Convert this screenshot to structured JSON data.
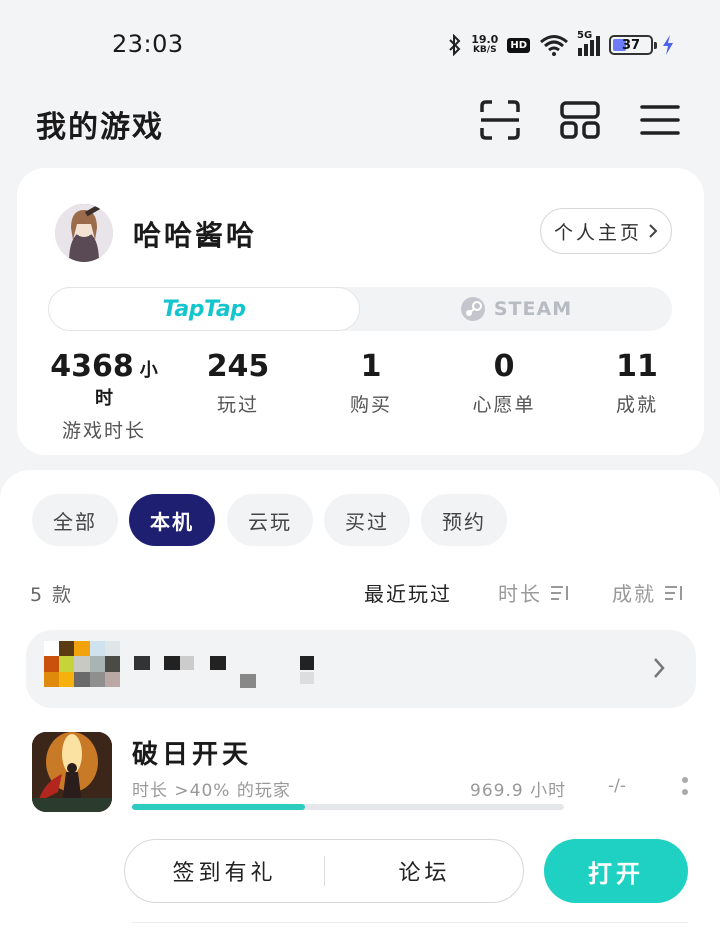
{
  "status_bar": {
    "time": "23:03",
    "net_speed_value": "19.0",
    "net_speed_unit": "KB/S",
    "hd": "HD",
    "signal": "5G",
    "battery": "37",
    "battery_level": 0.37
  },
  "header": {
    "title": "我的游戏",
    "icons": [
      "scan-icon",
      "grid-icon",
      "menu-icon"
    ]
  },
  "profile": {
    "username": "哈哈酱哈",
    "homepage_label": "个人主页",
    "platforms": {
      "taptap": "TapTap",
      "steam": "STEAM"
    },
    "stats": [
      {
        "value": "4368",
        "unit": "小时",
        "label": "游戏时长"
      },
      {
        "value": "245",
        "label": "玩过"
      },
      {
        "value": "1",
        "label": "购买"
      },
      {
        "value": "0",
        "label": "心愿单"
      },
      {
        "value": "11",
        "label": "成就"
      }
    ]
  },
  "filters": [
    "全部",
    "本机",
    "云玩",
    "买过",
    "预约"
  ],
  "active_filter": "本机",
  "list_header": {
    "count": "5 款",
    "sort_recent": "最近玩过",
    "sort_duration": "时长",
    "sort_achievements": "成就"
  },
  "game": {
    "name": "破日开天",
    "meta": "时长 >40% 的玩家",
    "hours": "969.9 小时",
    "achievements": "-/-",
    "progress": 0.4,
    "checkin_label": "签到有礼",
    "forum_label": "论坛",
    "open_label": "打开"
  },
  "colors": {
    "accent_teal": "#1fd1c2",
    "active_chip": "#1f1f72",
    "taptap_brand": "#15c5ce"
  }
}
